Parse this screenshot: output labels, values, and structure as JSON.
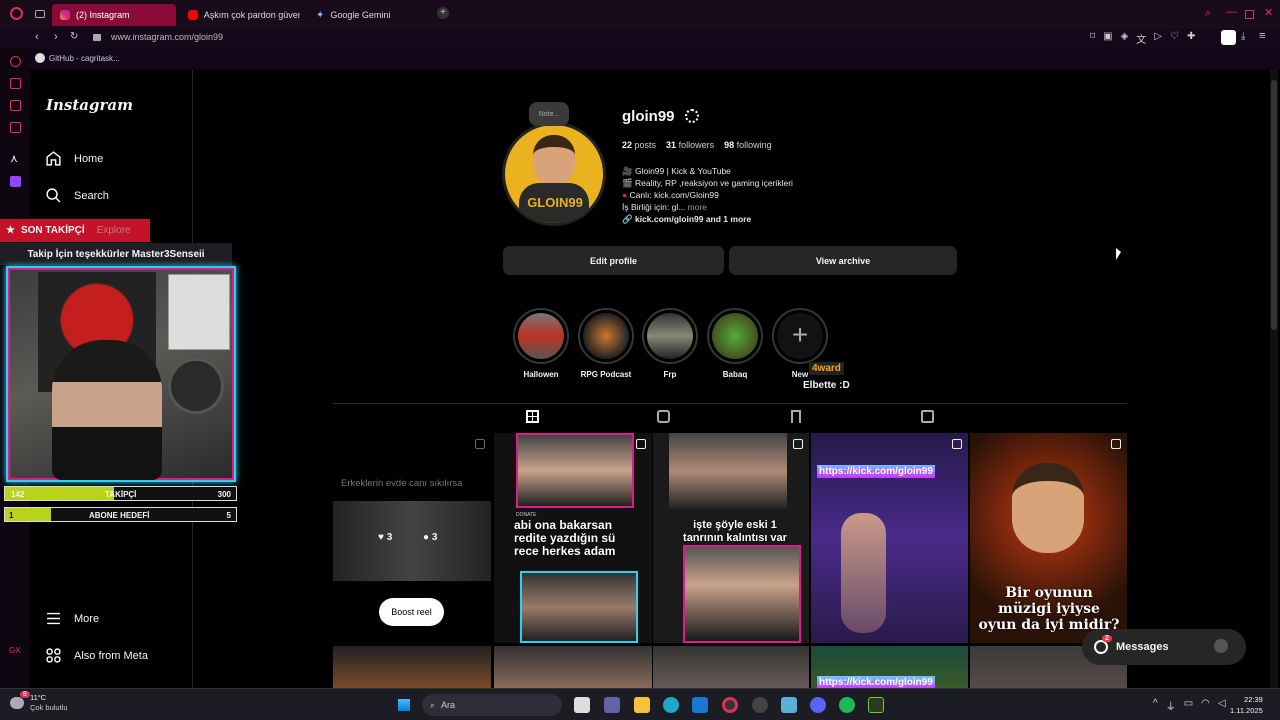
{
  "browser": {
    "tabs": [
      {
        "label": "(2) Instagram",
        "active": true
      },
      {
        "label": "Aşkım çok pardon güven",
        "active": false
      },
      {
        "label": "Google Gemini",
        "active": false
      }
    ],
    "url": "www.instagram.com/gloin99",
    "bookmark": "GitHub - cagritask..."
  },
  "sidebar": {
    "logo": "Instagram",
    "items": [
      {
        "label": "Home",
        "icon": "home-icon"
      },
      {
        "label": "Search",
        "icon": "search-icon"
      },
      {
        "label": "Explore",
        "icon": "explore-icon"
      }
    ],
    "more": "More",
    "meta": "Also from Meta"
  },
  "overlay": {
    "son_takipci": "SON TAKİPÇİ",
    "thanks": "Takip İçin teşekkürler Master3Senseii",
    "takipci_current": "142",
    "takipci_label": "TAKİPÇİ",
    "takipci_goal": "300",
    "takipci_progress": 0.47,
    "abone_current": "1",
    "abone_label": "ABONE HEDEFİ",
    "abone_goal": "5",
    "abone_progress": 0.2
  },
  "profile": {
    "note": "Note...",
    "avatar_text": "GLOIN99",
    "username": "gloin99",
    "posts_count": "22",
    "posts_label": "posts",
    "followers_count": "31",
    "followers_label": "followers",
    "following_count": "98",
    "following_label": "following",
    "bio": [
      "Gloin99 | Kick & YouTube",
      "Reality, RP ,reaksiyon ve gaming içerikleri",
      "Canlı: kick.com/Gloin99"
    ],
    "bio_more_prefix": "İş Birliği için: gl...",
    "bio_more": "more",
    "link": "kick.com/gloin99 and 1 more",
    "edit_profile": "Edit profile",
    "view_archive": "View archive",
    "highlights": [
      "Hallowen",
      "RPG Podcast",
      "Frp",
      "Babaq",
      "New"
    ],
    "chat_user": "4ward",
    "chat_msg": "Elbette :D"
  },
  "posts": {
    "p1_text": "Erkeklerin evde canı sıkılırsa",
    "p1_likes": "3",
    "p1_comments": "3",
    "p1_boost": "Boost reel",
    "p2_donate": "DONATE",
    "p2_caption": "abi ona bakarsan redite yazdığın sü rece herkes adam",
    "p3_caption": "işte şöyle eski 1 tanrının kalıntısı var",
    "p4_caption": "https://kick.com/gloin99",
    "p5_caption": "Bir oyunun müzigi iyiyse oyun da iyi midir?",
    "row2_text": "https://kick.com/gloin99"
  },
  "messages": {
    "label": "Messages",
    "badge": "2"
  },
  "taskbar": {
    "temp": "11°C",
    "weather": "Çok bulutlu",
    "weather_badge": "8",
    "search": "Ara",
    "time": "22:39",
    "date": "1.11.2025"
  },
  "colors": {
    "accent": "#e0305a",
    "overlay_red": "#c4122a",
    "cam_border": "#2ad1f0",
    "progress": "#b8d41a"
  }
}
